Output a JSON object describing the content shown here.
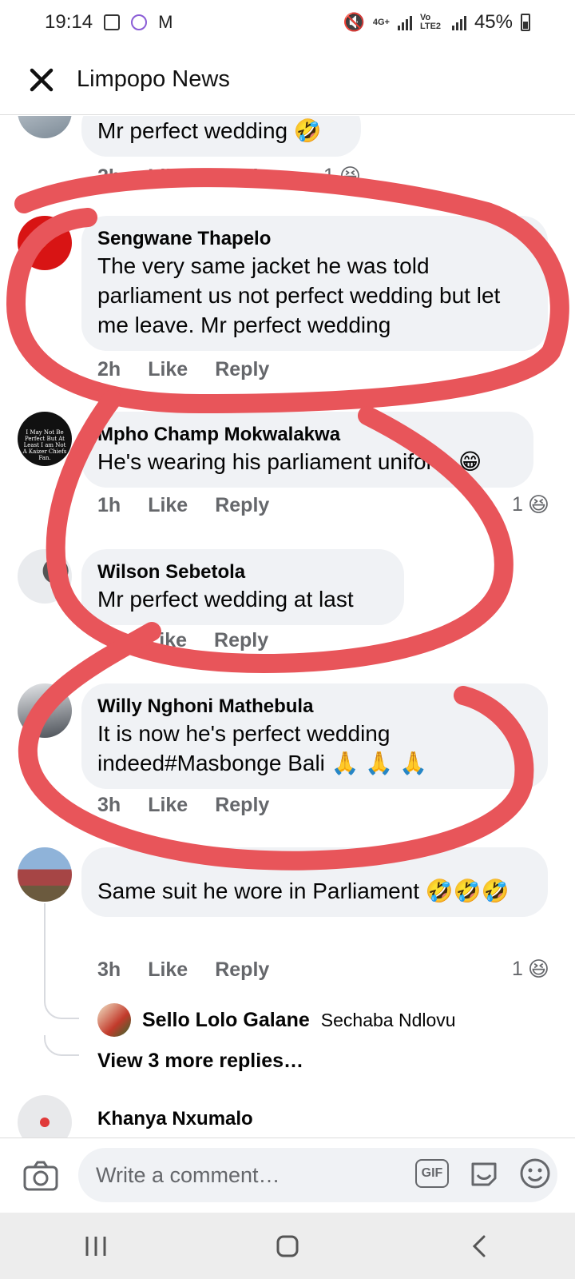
{
  "status_bar": {
    "time": "19:14",
    "network_4g": "4G+",
    "volte": "Vo LTE2",
    "battery": "45%"
  },
  "header": {
    "title": "Limpopo News"
  },
  "comments": [
    {
      "author": "",
      "text": "Mr perfect wedding 🤣",
      "time": "2h",
      "like": "Like",
      "reply": "Reply",
      "reaction_count": "1",
      "reaction_emoji": "😆"
    },
    {
      "author": "Sengwane Thapelo",
      "text": "The very same jacket he was told parliament us not perfect wedding but let me leave. Mr perfect wedding",
      "time": "2h",
      "like": "Like",
      "reply": "Reply"
    },
    {
      "author": "Mpho Champ Mokwalakwa",
      "text": "He's wearing his parliament uniform 😁",
      "time": "1h",
      "like": "Like",
      "reply": "Reply",
      "reaction_count": "1",
      "reaction_emoji": "😆"
    },
    {
      "author": "Wilson Sebetola",
      "text": "Mr perfect wedding at last",
      "time": "",
      "like": "Like",
      "reply": "Reply"
    },
    {
      "author": "Willy Nghoni Mathebula",
      "text": "It is now he's perfect wedding indeed#Masbonge Bali 🙏 🙏 🙏",
      "time": "3h",
      "like": "Like",
      "reply": "Reply"
    },
    {
      "author": "",
      "text": "Same suit he wore in Parliament 🤣🤣🤣",
      "time": "3h",
      "like": "Like",
      "reply": "Reply",
      "reaction_count": "1",
      "reaction_emoji": "😆",
      "reply_preview": {
        "author": "Sello Lolo Galane",
        "mention": "Sechaba Ndlovu"
      },
      "view_more": "View 3 more replies…"
    },
    {
      "author": "Khanya Nxumalo",
      "text": ""
    }
  ],
  "avatar_badge_text": "I May Not Be Perfect But At Least I am Not A Kaizer Chiefs Fan.",
  "composer": {
    "placeholder": "Write a comment…",
    "gif_label": "GIF"
  },
  "colors": {
    "bubble": "#f0f2f5",
    "secondary_text": "#65676b",
    "scribble": "#e8555a"
  }
}
